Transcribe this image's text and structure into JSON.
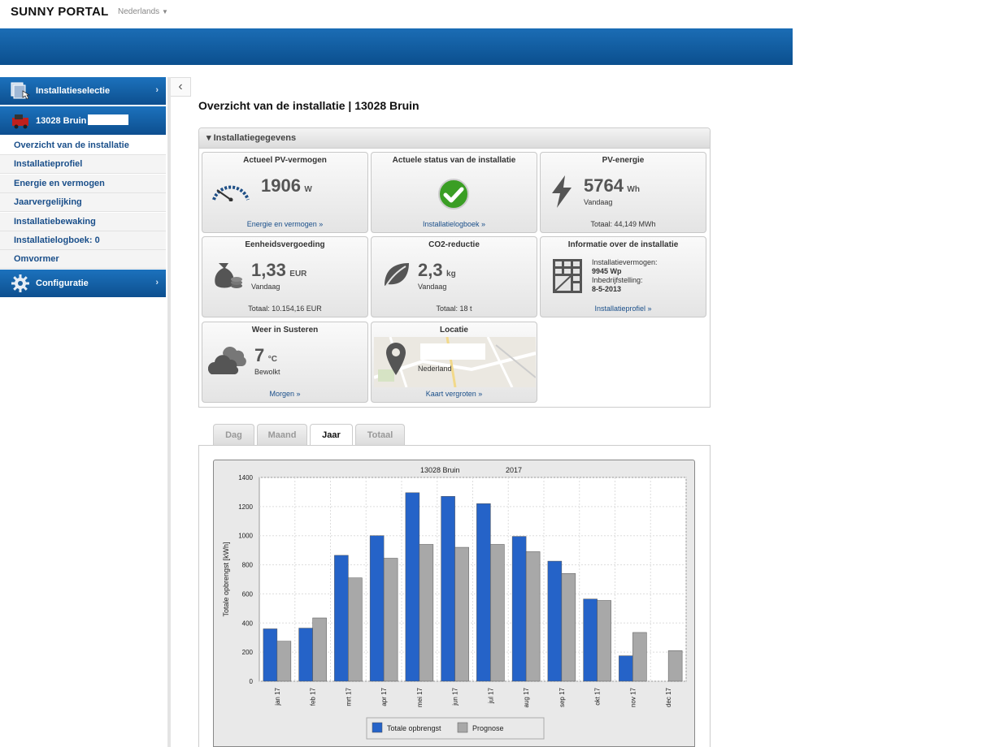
{
  "header": {
    "brand": "SUNNY PORTAL",
    "language": "Nederlands",
    "language_chevron": "chevron-down-icon"
  },
  "sidebar": {
    "installatieselectie": "Installatieselectie",
    "plant_name": "13028 Bruin",
    "items": [
      {
        "label": "Overzicht van de installatie"
      },
      {
        "label": "Installatieprofiel"
      },
      {
        "label": "Energie en vermogen"
      },
      {
        "label": "Jaarvergelijking"
      },
      {
        "label": "Installatiebewaking"
      },
      {
        "label": "Installatielogboek: 0"
      },
      {
        "label": "Omvormer"
      }
    ],
    "configuratie": "Configuratie",
    "chevron": "›",
    "collapse": "‹"
  },
  "page": {
    "title": "Overzicht van de installatie | 13028 Bruin"
  },
  "panel": {
    "title": "▾ Installatiegegevens"
  },
  "tiles": {
    "pv_power": {
      "title": "Actueel PV-vermogen",
      "value": "1906",
      "unit": "W",
      "link": "Energie en vermogen »"
    },
    "status": {
      "title": "Actuele status van de installatie",
      "link": "Installatielogboek »",
      "status_color": "#3a9e24"
    },
    "pv_energy": {
      "title": "PV-energie",
      "value": "5764",
      "unit": "Wh",
      "sub": "Vandaag",
      "total": "Totaal: 44,149 MWh"
    },
    "compensation": {
      "title": "Eenheidsvergoeding",
      "value": "1,33",
      "unit": "EUR",
      "sub": "Vandaag",
      "total": "Totaal: 10.154,16 EUR"
    },
    "co2": {
      "title": "CO2-reductie",
      "value": "2,3",
      "unit": "kg",
      "sub": "Vandaag",
      "total": "Totaal: 18 t"
    },
    "info": {
      "title": "Informatie over de installatie",
      "capacity_label": "Installatievermogen:",
      "capacity": "9945 Wp",
      "commission_label": "Inbedrijfstelling:",
      "commission": "8-5-2013",
      "link": "Installatieprofiel »"
    },
    "weather": {
      "title": "Weer in Susteren",
      "value": "7",
      "unit": "°C",
      "sub": "Bewolkt",
      "link": "Morgen »"
    },
    "location": {
      "title": "Locatie",
      "country": "Nederland",
      "link": "Kaart vergroten »"
    }
  },
  "tabs": [
    {
      "label": "Dag"
    },
    {
      "label": "Maand"
    },
    {
      "label": "Jaar"
    },
    {
      "label": "Totaal"
    }
  ],
  "chart_data": {
    "type": "bar",
    "title": "13028 Bruin",
    "subtitle": "2017",
    "ylabel": "Totale opbrengst [kWh]",
    "xlabel": "",
    "ylim": [
      0,
      1400
    ],
    "yticks": [
      0,
      200,
      400,
      600,
      800,
      1000,
      1200,
      1400
    ],
    "categories": [
      "jan 17",
      "feb 17",
      "mrt 17",
      "apr 17",
      "mei 17",
      "jun 17",
      "jul 17",
      "aug 17",
      "sep 17",
      "okt 17",
      "nov 17",
      "dec 17"
    ],
    "series": [
      {
        "name": "Totale opbrengst",
        "color": "#2563c8",
        "values": [
          360,
          365,
          865,
          1000,
          1295,
          1270,
          1220,
          995,
          825,
          565,
          175,
          null
        ]
      },
      {
        "name": "Prognose",
        "color": "#a8a8a8",
        "values": [
          275,
          435,
          710,
          845,
          940,
          920,
          940,
          890,
          740,
          555,
          335,
          210
        ]
      }
    ],
    "grid": true,
    "legend": "bottom-center"
  }
}
